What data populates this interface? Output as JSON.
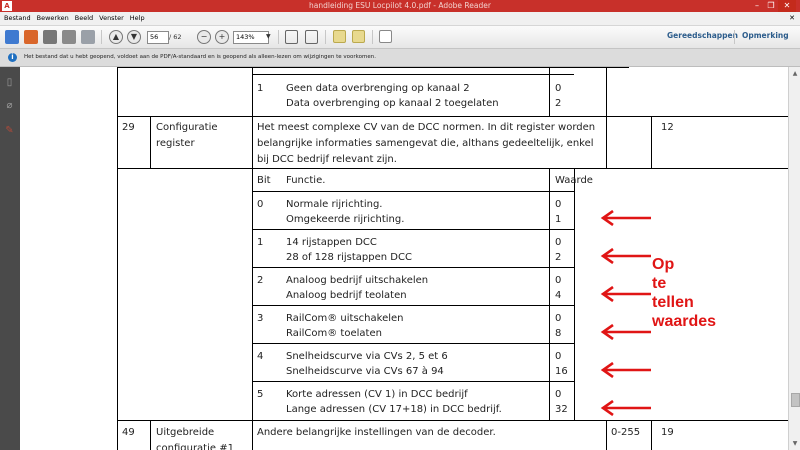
{
  "window": {
    "title": "handleiding ESU Locpilot 4.0.pdf - Adobe Reader"
  },
  "menu": [
    "Bestand",
    "Bewerken",
    "Beeld",
    "Venster",
    "Help"
  ],
  "toolbar": {
    "page_current": "56",
    "page_total": "/ 62",
    "zoom": "143%",
    "tools_label": "Gereedschappen",
    "comment_label": "Opmerking"
  },
  "infobar": {
    "message": "Het bestand dat u hebt geopend, voldoet aan de PDF/A-standaard en is geopend als alleen-lezen om wijzigingen te voorkomen."
  },
  "doc": {
    "row1": {
      "bit": "1",
      "func_line1": "Geen data overbrenging op kanaal 2",
      "func_line2": "Data overbrenging op kanaal 2 toegelaten",
      "val_line1": "0",
      "val_line2": "2"
    },
    "cv29": {
      "number": "29",
      "name_line1": "Configuratie",
      "name_line2": "register",
      "desc_line1": "Het meest complexe CV van de DCC normen. In dit register worden",
      "desc_line2": "belangrijke informaties samengevat die, althans gedeeltelijk, enkel",
      "desc_line3": "bij DCC bedrijf relevant zijn.",
      "default": "12"
    },
    "headers": {
      "bit": "Bit",
      "function": "Functie.",
      "value": "Waarde"
    },
    "bits": [
      {
        "bit": "0",
        "line1": "Normale rijrichting.",
        "line2": "Omgekeerde rijrichting.",
        "val1": "0",
        "val2": "1"
      },
      {
        "bit": "1",
        "line1": "14 rijstappen DCC",
        "line2": "28 of 128 rijstappen DCC",
        "val1": "0",
        "val2": "2"
      },
      {
        "bit": "2",
        "line1": "Analoog bedrijf uitschakelen",
        "line2": "Analoog bedrijf teolaten",
        "val1": "0",
        "val2": "4"
      },
      {
        "bit": "3",
        "line1": "RailCom® uitschakelen",
        "line2": "RailCom® toelaten",
        "val1": "0",
        "val2": "8"
      },
      {
        "bit": "4",
        "line1": "Snelheidscurve via CVs 2, 5 et 6",
        "line2": "Snelheidscurve via CVs 67 à 94",
        "val1": "0",
        "val2": "16"
      },
      {
        "bit": "5",
        "line1": "Korte adressen (CV 1) in DCC bedrijf",
        "line2": "Lange adressen (CV 17+18) in DCC bedrijf.",
        "val1": "0",
        "val2": "32"
      }
    ],
    "cv49": {
      "number": "49",
      "name_line1": "Uitgebreide",
      "name_line2": "configuratie #1",
      "desc": "Andere belangrijke instellingen van de decoder.",
      "range": "0-255",
      "default": "19"
    }
  },
  "annotation": {
    "line1": "Op",
    "line2": "te",
    "line3": "tellen",
    "line4": "waardes",
    "color": "#e01515"
  }
}
